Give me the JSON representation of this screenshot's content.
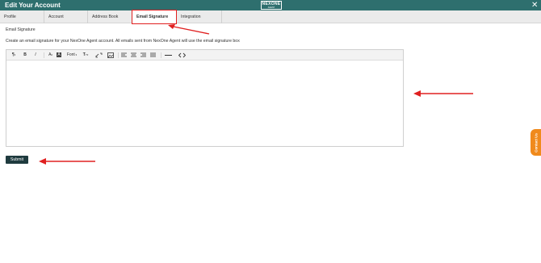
{
  "header": {
    "title": "Edit Your Account",
    "logo_text": "NEXONE",
    "logo_sub": "AGENT",
    "close_glyph": "✕"
  },
  "tabs": [
    {
      "label": "Profile",
      "active": false
    },
    {
      "label": "Account",
      "active": false
    },
    {
      "label": "Address Book",
      "active": false
    },
    {
      "label": "Email Signature",
      "active": true
    },
    {
      "label": "Integration",
      "active": false
    }
  ],
  "main": {
    "section_label": "Email Signature",
    "description": "Create an email signature for your NexOne Agent account. All emails sent from NexOne Agent will use the email signature box",
    "editor_value": ""
  },
  "toolbar": {
    "paragraph_glyph": "¶",
    "bold_glyph": "B",
    "italic_glyph": "I",
    "font_color_glyph": "A",
    "bg_color_glyph": "A",
    "font_label": "Font",
    "font_size_glyph": "T",
    "icons": [
      "paragraph-icon",
      "bold-icon",
      "italic-icon",
      "font-color-icon",
      "background-color-icon",
      "font-dropdown",
      "font-size-icon",
      "link-icon",
      "image-icon",
      "align-left-icon",
      "align-center-icon",
      "align-right-icon",
      "justify-icon",
      "horizontal-rule-icon",
      "code-view-icon"
    ]
  },
  "submit_label": "Submit",
  "contact_label": "Contact Us",
  "colors": {
    "header_bg": "#2e6f6e",
    "tab_bar_bg": "#ebebeb",
    "submit_bg": "#1f3b3f",
    "contact_bg": "#f08a1c",
    "annotation_red": "#e02020"
  }
}
